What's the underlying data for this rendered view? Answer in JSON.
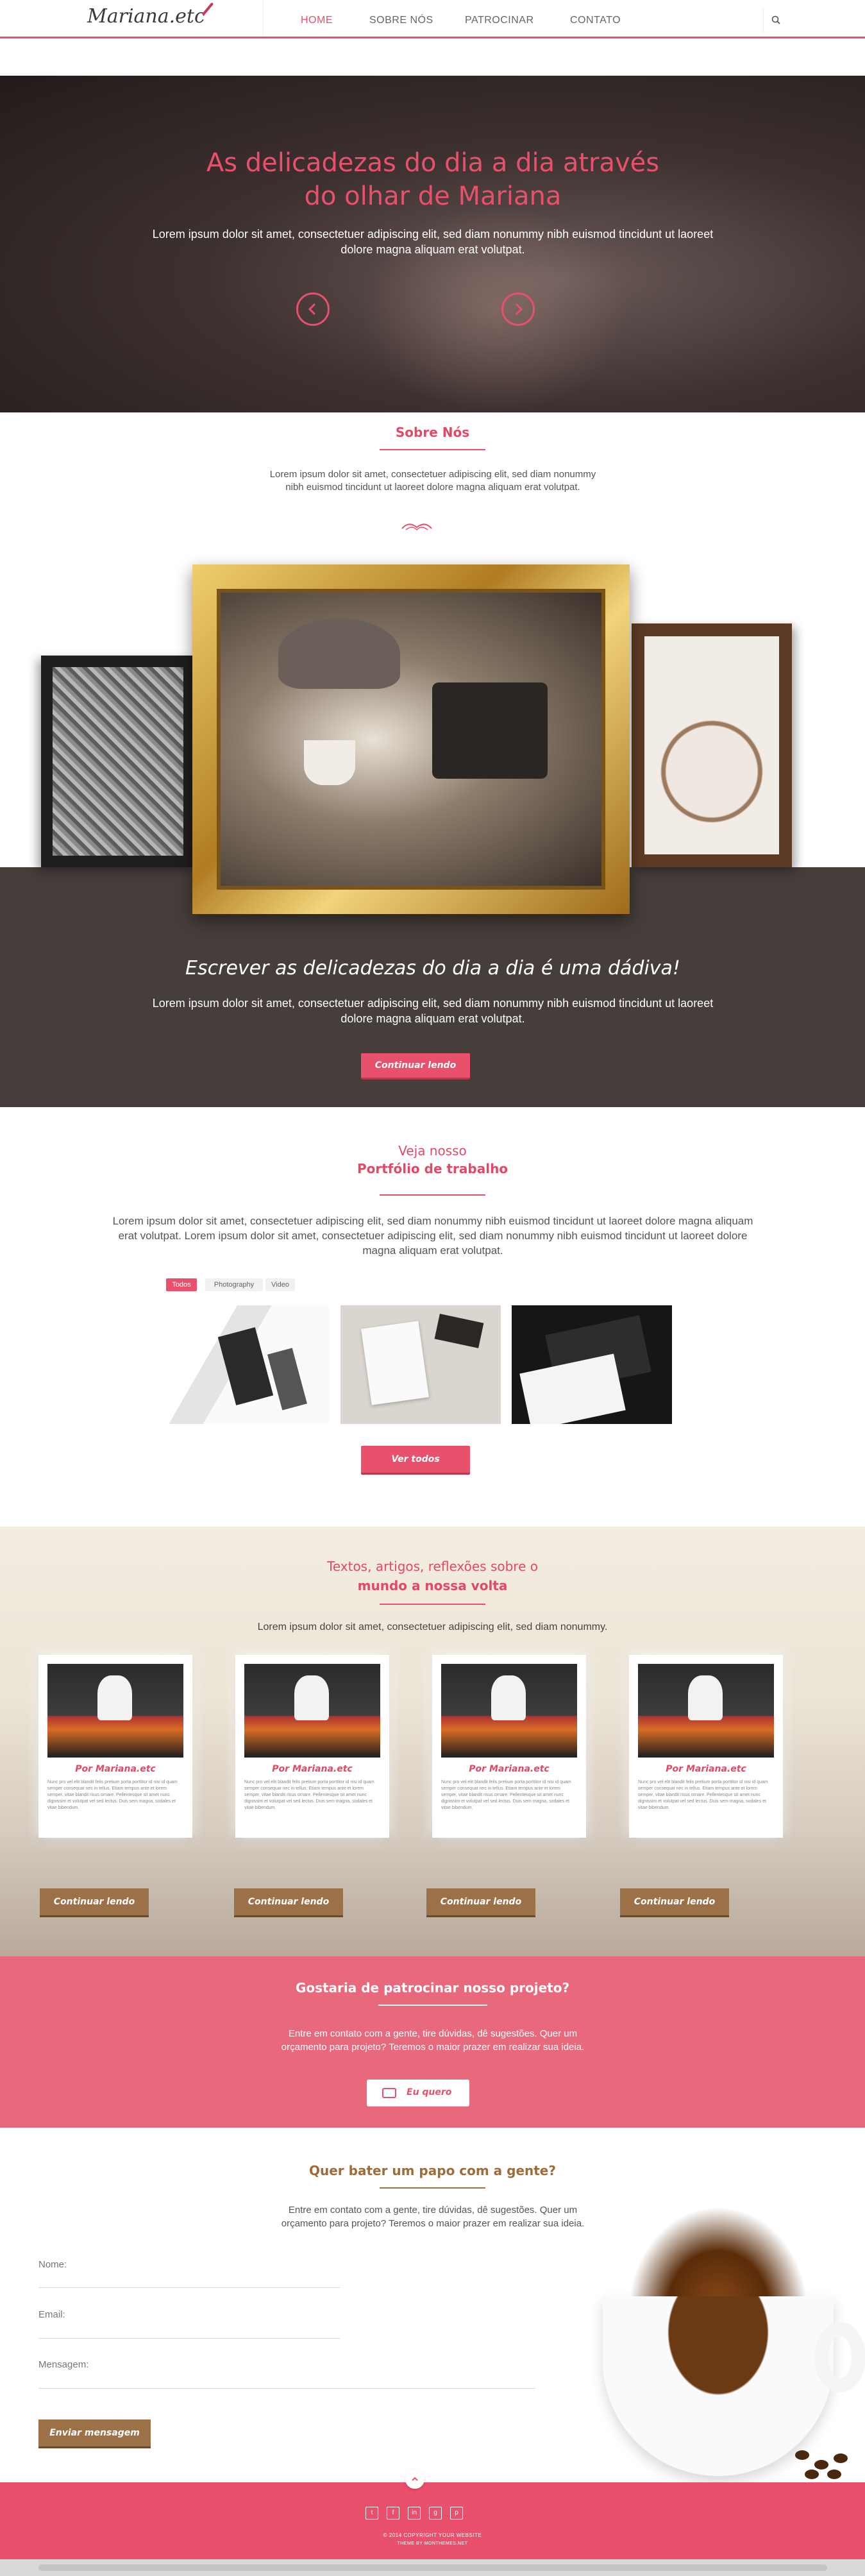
{
  "header": {
    "logo_text": "Mariana.etc",
    "nav": [
      "HOME",
      "SOBRE NÓS",
      "PATROCINAR",
      "CONTATO"
    ],
    "active_nav": "HOME"
  },
  "hero": {
    "title_line1": "As delicadezas do dia a dia através",
    "title_line2": "do olhar de Mariana",
    "text_line1": "Lorem ipsum dolor sit amet, consectetuer adipiscing elit, sed diam nonummy nibh euismod tincidunt ut laoreet",
    "text_line2": "dolore magna aliquam erat volutpat."
  },
  "about": {
    "title": "Sobre Nós",
    "text_line1": "Lorem ipsum dolor sit amet, consectetuer adipiscing elit, sed diam nonummy",
    "text_line2": "nibh euismod tincidunt ut laoreet dolore magna aliquam erat volutpat."
  },
  "highlight": {
    "title": "Escrever as delicadezas do dia a dia é uma dádiva!",
    "text_line1": "Lorem ipsum dolor sit amet, consectetuer adipiscing elit, sed diam nonummy nibh euismod tincidunt ut laoreet",
    "text_line2": "dolore magna aliquam erat volutpat.",
    "button": "Continuar lendo"
  },
  "portfolio": {
    "pre_title": "Veja nosso",
    "title": "Portfólio de trabalho",
    "text_line1": "Lorem ipsum dolor sit amet, consectetuer adipiscing elit, sed diam nonummy nibh euismod tincidunt ut laoreet dolore magna aliquam",
    "text_line2": "erat volutpat.  Lorem ipsum dolor sit amet, consectetuer adipiscing elit, sed diam nonummy nibh euismod tincidunt ut laoreet dolore",
    "text_line3": "magna aliquam erat volutpat.",
    "filters": [
      "Todos",
      "Photography",
      "Video"
    ],
    "button": "Ver todos"
  },
  "articles": {
    "pre_title": "Textos, artigos, reflexões sobre o",
    "title": "mundo a nossa volta",
    "text": "Lorem ipsum dolor sit amet, consectetuer adipiscing elit, sed diam nonummy.",
    "cards": [
      {
        "by": "Por Mariana.etc",
        "excerpt": "Nunc pro vel elit blandit felis pretium porta porttitor id nisi id quam semper consequat nec in tellus. Etiam tempus ante et lorem semper, vitae blandit risus ornare. Pellentesque sit amet nunc dignissim et volutpat vel sed lectus. Duis sem magna, sodales et vitae bibendum.",
        "button": "Continuar lendo"
      },
      {
        "by": "Por Mariana.etc",
        "excerpt": "Nunc pro vel elit blandit felis pretium porta porttitor id nisi id quam semper consequat nec in tellus. Etiam tempus ante et lorem semper, vitae blandit risus ornare. Pellentesque sit amet nunc dignissim et volutpat vel sed lectus. Duis sem magna, sodales et vitae bibendum.",
        "button": "Continuar lendo"
      },
      {
        "by": "Por Mariana.etc",
        "excerpt": "Nunc pro vel elit blandit felis pretium porta porttitor id nisi id quam semper consequat nec in tellus. Etiam tempus ante et lorem semper, vitae blandit risus ornare. Pellentesque sit amet nunc dignissim et volutpat vel sed lectus. Duis sem magna, sodales et vitae bibendum.",
        "button": "Continuar lendo"
      },
      {
        "by": "Por Mariana.etc",
        "excerpt": "Nunc pro vel elit blandit felis pretium porta porttitor id nisi id quam semper consequat nec in tellus. Etiam tempus ante et lorem semper, vitae blandit risus ornare. Pellentesque sit amet nunc dignissim et volutpat vel sed lectus. Duis sem magna, sodales et vitae bibendum.",
        "button": "Continuar lendo"
      }
    ]
  },
  "sponsor": {
    "title": "Gostaria de patrocinar nosso projeto?",
    "text_line1": "Entre em contato com a gente, tire dúvidas, dê sugestões. Quer um",
    "text_line2": "orçamento para projeto? Teremos o maior prazer em realizar sua ideia.",
    "button": "Eu quero"
  },
  "contact": {
    "title": "Quer bater um papo com a gente?",
    "text_line1": "Entre em contato com a gente, tire dúvidas, dê sugestões. Quer um",
    "text_line2": "orçamento para projeto? Teremos o maior prazer em realizar sua ideia.",
    "labels": {
      "name": "Nome:",
      "email": "Email:",
      "message": "Mensagem:"
    },
    "button": "Enviar mensagem"
  },
  "footer": {
    "social": [
      "t",
      "f",
      "in",
      "g",
      "p"
    ],
    "copyright": "© 2014 COPYRIGHT YOUR WEBSITE",
    "credit": "THEME BY MONTHEMES.NET"
  },
  "colors": {
    "accent": "#e8506b",
    "brown": "#9c7148",
    "dark": "#453e3b"
  }
}
